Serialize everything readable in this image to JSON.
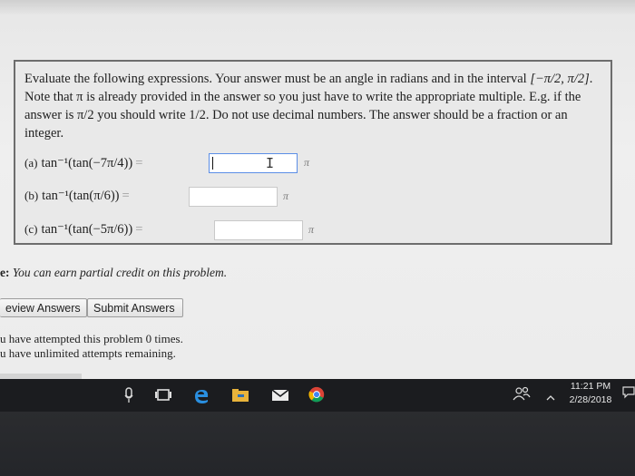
{
  "problem": {
    "instructions_text": "Evaluate the following expressions. Your answer must be an angle in radians and in the interval",
    "interval": "[−π/2, π/2]",
    "instructions_rest": ". Note that π is already provided in the answer so you just have to write the appropriate multiple. E.g. if the answer is π/2 you should write 1/2. Do not use decimal numbers. The answer should be a fraction or an integer.",
    "parts": [
      {
        "label": "(a)",
        "expr": "tan⁻¹(tan(−7π/4))",
        "eq": "=",
        "value": "",
        "unit": "π"
      },
      {
        "label": "(b)",
        "expr": "tan⁻¹(tan(π/6))",
        "eq": "=",
        "value": "",
        "unit": "π"
      },
      {
        "label": "(c)",
        "expr": "tan⁻¹(tan(−5π/6))",
        "eq": "=",
        "value": "",
        "unit": "π"
      }
    ]
  },
  "note": {
    "prefix": "e:",
    "text": "You can earn partial credit on this problem."
  },
  "buttons": {
    "preview": "eview Answers",
    "submit": "Submit Answers"
  },
  "attempts": {
    "line1": "u have attempted this problem 0 times.",
    "line2": "u have unlimited attempts remaining."
  },
  "taskbar": {
    "time": "11:21 PM",
    "date": "2/28/2018",
    "icons": [
      "mic-icon",
      "task-view-icon",
      "edge-icon",
      "file-explorer-icon",
      "mail-icon",
      "chrome-icon",
      "people-icon",
      "chevron-up-icon",
      "notification-icon"
    ],
    "accent": "#1b1c1f"
  }
}
